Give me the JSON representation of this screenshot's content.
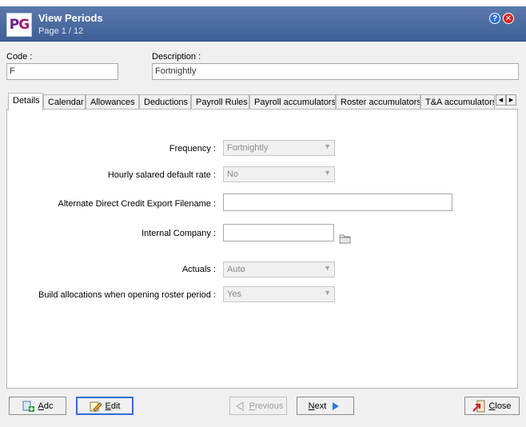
{
  "window": {
    "title": "View Periods",
    "page_info": "Page 1 / 12",
    "logo_text_p": "P",
    "logo_text_g": "G",
    "help_glyph": "?",
    "close_glyph": "✕",
    "icons": {
      "help": "help-icon",
      "close": "close-window-icon"
    }
  },
  "header": {
    "code_label": "Code :",
    "code_value": "F",
    "description_label": "Description :",
    "description_value": "Fortnightly"
  },
  "tabs": [
    {
      "label": "Details",
      "active": true
    },
    {
      "label": "Calendar"
    },
    {
      "label": "Allowances"
    },
    {
      "label": "Deductions"
    },
    {
      "label": "Payroll Rules"
    },
    {
      "label": "Payroll accumulators"
    },
    {
      "label": "Roster accumulators"
    },
    {
      "label": "T&A accumulators"
    }
  ],
  "tab_scroll": {
    "left": "◀",
    "right": "▶"
  },
  "details": {
    "frequency_label": "Frequency :",
    "frequency_value": "Fortnightly",
    "hourly_label": "Hourly salared default rate :",
    "hourly_value": "No",
    "export_label": "Alternate Direct Credit Export Filename :",
    "export_value": "",
    "company_label": "Internal Company :",
    "company_value": "",
    "actuals_label": "Actuals :",
    "actuals_value": "Auto",
    "build_label": "Build allocations when opening roster period :",
    "build_value": "Yes",
    "dropdown_arrow": "▼"
  },
  "buttons": {
    "add_u": "A",
    "add_rest": "dc",
    "edit_u": "E",
    "edit_rest": "dit",
    "previous_u": "P",
    "previous_rest": "revious",
    "next_u": "N",
    "next_rest": "ext",
    "close_u": "C",
    "close_rest": "lose",
    "previous_enabled": false
  },
  "colors": {
    "titlebar": "#4a6aa1",
    "focus_border": "#2e6fd1",
    "next_arrow": "#2d7bd8",
    "close_icon": "#c8202a"
  }
}
